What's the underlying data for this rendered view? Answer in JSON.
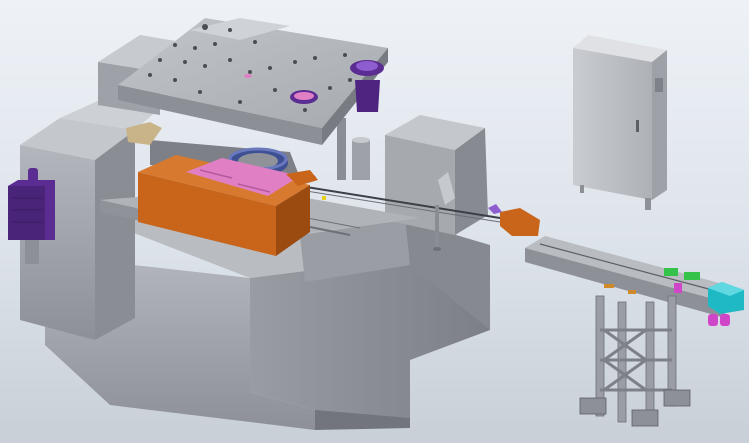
{
  "viewport": {
    "title_fragment": "",
    "background_top": "#eef2f7",
    "background_bottom": "#c9cfd7"
  },
  "model": {
    "colors": {
      "frame": "#a3a7ad",
      "frame_dark": "#7f8389",
      "frame_light": "#c7cbd0",
      "orange": "#c8651b",
      "orange_dark": "#9c4b10",
      "pink": "#e07fc4",
      "purple": "#5b2d92",
      "purple_light": "#8e5dcf",
      "blue_ring": "#4b5ea7",
      "cyan": "#1fb9c6",
      "green": "#34c24a",
      "magenta": "#d046c9"
    },
    "parts": [
      "main-press-frame",
      "top-die-plate",
      "feeder-box",
      "purple-motor",
      "electrical-cabinet",
      "output-conveyor",
      "conveyor-support-stand"
    ]
  }
}
